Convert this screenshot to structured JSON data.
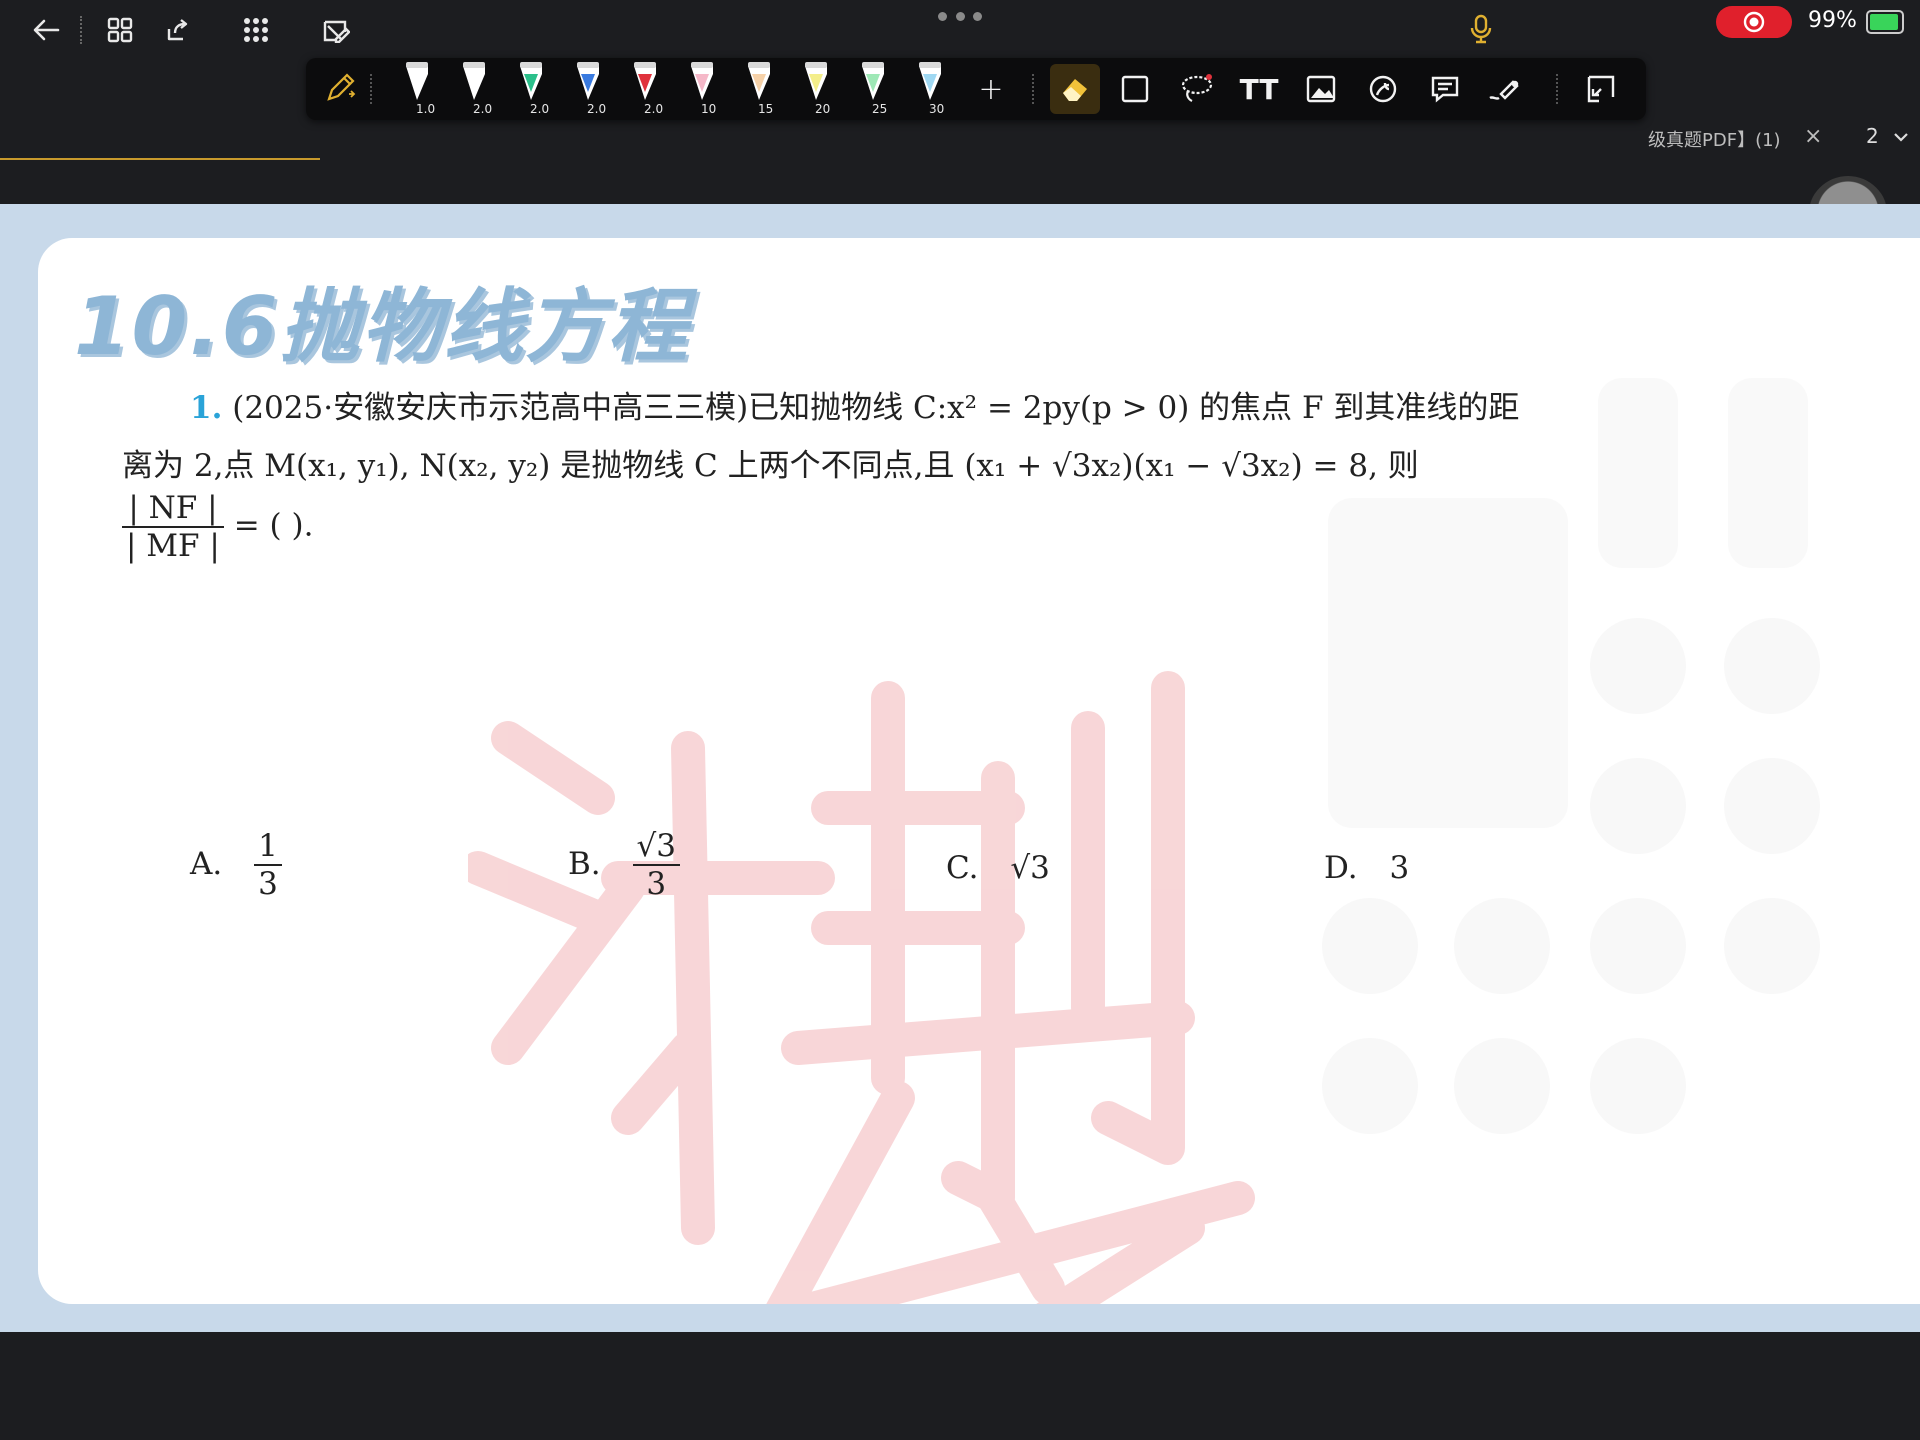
{
  "status": {
    "battery_percent": "99%",
    "colors": {
      "accent": "#c89a2c",
      "record": "#e0202c",
      "battery": "#39d45a"
    }
  },
  "topbar": {
    "icons": [
      "back-arrow-icon",
      "grid-icon",
      "export-icon",
      "apps-icon",
      "edit-cancel-icon"
    ],
    "more_icon": "more-dots-icon"
  },
  "tab": {
    "label": "级真题PDF】(1)",
    "close_label": "×",
    "page_number": "2"
  },
  "toolbar": {
    "pens": [
      {
        "size": "1.0",
        "color": "#ffffff"
      },
      {
        "size": "2.0",
        "color": "#ffffff"
      },
      {
        "size": "2.0",
        "color": "#2bbf8a"
      },
      {
        "size": "2.0",
        "color": "#3a7be0"
      },
      {
        "size": "2.0",
        "color": "#e0323c"
      },
      {
        "size": "10",
        "color": "#f5b8c8"
      },
      {
        "size": "15",
        "color": "#f6d1a8"
      },
      {
        "size": "20",
        "color": "#f4ee8a"
      },
      {
        "size": "25",
        "color": "#9ee8b6"
      },
      {
        "size": "30",
        "color": "#9fd8f2"
      }
    ],
    "add_label": "+",
    "text_tool_label": "TT",
    "tools": [
      "eraser-icon",
      "shape-icon",
      "lasso-icon",
      "text-icon",
      "image-icon",
      "sticker-icon",
      "comment-icon",
      "laser-pointer-icon",
      "crop-icon"
    ]
  },
  "document": {
    "section_title": "10.6抛物线方程",
    "question": {
      "number": "1.",
      "line1": "(2025·安徽安庆市示范高中高三三模)已知抛物线 C:x² = 2py(p > 0) 的焦点 F 到其准线的距",
      "line2": "离为 2,点 M(x₁, y₁), N(x₂, y₂) 是抛物线 C 上两个不同点,且 (x₁ + √3x₂)(x₁ − √3x₂) = 8, 则",
      "frac_num": "| NF |",
      "frac_den": "| MF |",
      "frac_tail": "= (        )."
    },
    "options": [
      {
        "label": "A.",
        "num": "1",
        "den": "3"
      },
      {
        "label": "B.",
        "num": "√3",
        "den": "3"
      },
      {
        "label": "C.",
        "value": "√3"
      },
      {
        "label": "D.",
        "value": "3"
      }
    ]
  }
}
